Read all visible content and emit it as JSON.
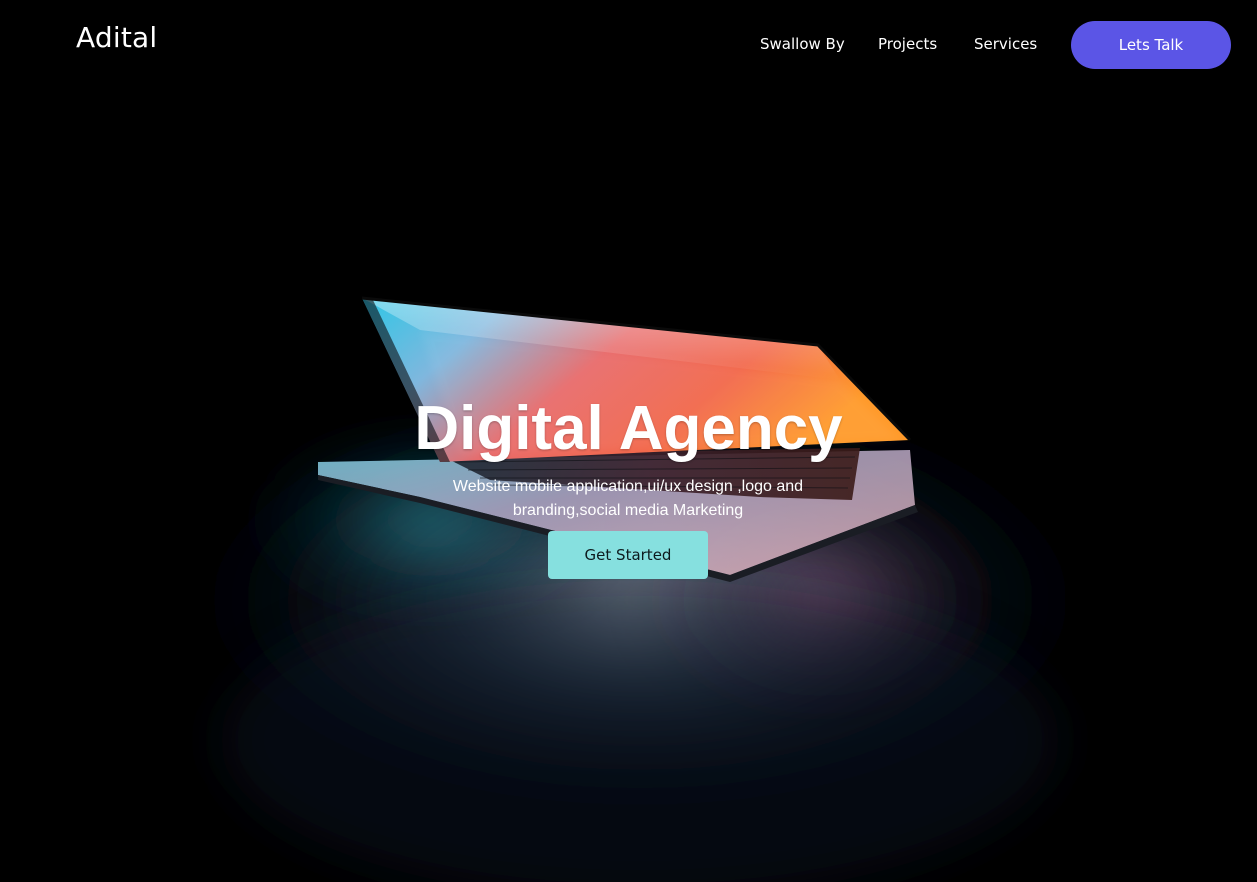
{
  "brand": {
    "name": "Adital"
  },
  "nav": {
    "items": [
      {
        "label": "Swallow By"
      },
      {
        "label": "Projects"
      },
      {
        "label": "Services"
      }
    ],
    "cta_label": "Lets Talk"
  },
  "hero": {
    "title": "Digital Agency",
    "subtitle": "Website mobile application,ui/ux design ,logo and branding,social media Marketing",
    "button_label": "Get Started"
  },
  "colors": {
    "background": "#000000",
    "cta_purple": "#5b55e6",
    "get_started_teal": "#86e0df"
  },
  "background_image": {
    "depicts": "laptop-partially-open-glowing-screen-on-dark-desk"
  }
}
